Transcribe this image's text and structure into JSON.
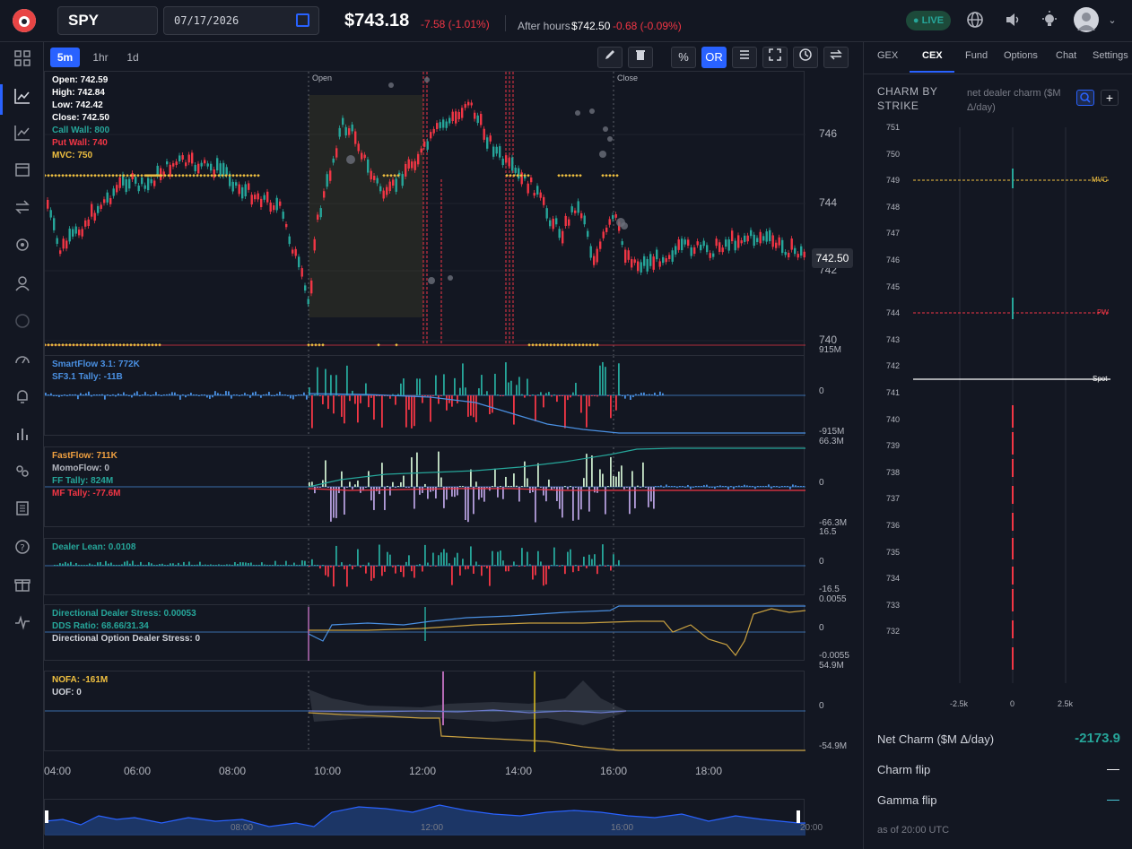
{
  "header": {
    "ticker": "SPY",
    "date": "07/17/2026",
    "price": "$743.18",
    "change": "-7.58 (-1.01%)",
    "after_hours_label": "After hours",
    "after_hours_price": "$742.50",
    "after_hours_change": "-0.68 (-0.09%)",
    "live_label": "● LIVE"
  },
  "timeframes": [
    "5m",
    "1hr",
    "1d"
  ],
  "toolbar": {
    "pencil_icon": "pencil-icon",
    "trash_icon": "trash-icon",
    "percent_label": "%",
    "or_label": "OR",
    "menu_icon": "menu-icon",
    "fullscreen_icon": "fullscreen-icon",
    "clock_icon": "clock-icon",
    "swap_icon": "swap-icon"
  },
  "sidebar_icons": [
    "grid-icon",
    "chart-line-icon",
    "trend-icon",
    "calendar-icon",
    "transfer-icon",
    "target-icon",
    "user-icon",
    "chat-icon",
    "gauge-icon",
    "bell-icon",
    "bar-chart-icon",
    "group-icon",
    "news-icon",
    "help-icon",
    "gift-icon",
    "pulse-icon"
  ],
  "price_pane": {
    "open": "Open: 742.59",
    "high": "High: 742.84",
    "low": "Low: 742.42",
    "close": "Close: 742.50",
    "call_wall": "Call Wall: 800",
    "put_wall": "Put Wall: 740",
    "mvc": "MVC: 750",
    "session_open": "Open",
    "session_close": "Close",
    "last_price": "742.50",
    "axis": [
      "746",
      "744",
      "742",
      "740"
    ]
  },
  "panes": {
    "smartflow": {
      "line1": "SmartFlow 3.1: 772K",
      "line2": "SF3.1 Tally: -11B",
      "top": "915M",
      "zero": "0",
      "bottom": "-915M"
    },
    "fastflow": {
      "line1": "FastFlow: 711K",
      "line2": "MomoFlow: 0",
      "line3": "FF Tally: 824M",
      "line4": "MF Tally: -77.6M",
      "top": "66.3M",
      "zero": "0",
      "bottom": "-66.3M"
    },
    "dealer": {
      "line1": "Dealer Lean: 0.0108",
      "top": "16.5",
      "zero": "0",
      "bottom": "-16.5"
    },
    "dds": {
      "line1": "Directional Dealer Stress: 0.00053",
      "line2": "DDS Ratio: 68.66/31.34",
      "line3": "Directional Option Dealer Stress: 0",
      "top": "0.0055",
      "zero": "0",
      "bottom": "-0.0055"
    },
    "nofa": {
      "line1": "NOFA: -161M",
      "line2": "UOF: 0",
      "top": "54.9M",
      "zero": "0",
      "bottom": "-54.9M"
    }
  },
  "time_axis": [
    "04:00",
    "06:00",
    "08:00",
    "10:00",
    "12:00",
    "14:00",
    "16:00",
    "18:00"
  ],
  "navigator": [
    "08:00",
    "12:00",
    "16:00",
    "20:00"
  ],
  "colors": {
    "accent": "#2962ff",
    "up": "#26a69a",
    "down": "#f23645",
    "mvc": "#f0c040",
    "flow_line": "#4a90e2"
  },
  "right_panel": {
    "tabs": [
      "GEX",
      "CEX",
      "Fund",
      "Options",
      "Chat",
      "Settings"
    ],
    "active_tab": "CEX",
    "title": "CHARM BY STRIKE",
    "subtitle": "net dealer charm ($M Δ/day)",
    "search_icon": "search-icon",
    "add_label": "+",
    "strikes": [
      "751",
      "750",
      "749",
      "748",
      "747",
      "746",
      "745",
      "744",
      "743",
      "742",
      "741",
      "740",
      "739",
      "738",
      "737",
      "736",
      "735",
      "734",
      "733",
      "732"
    ],
    "x_ticks": [
      "-2.5k",
      "0",
      "2.5k"
    ],
    "tags": {
      "mvc": "MVC",
      "pw": "PW",
      "spot": "Spot"
    },
    "net_charm_label": "Net Charm ($M Δ/day)",
    "net_charm_value": "-2173.9",
    "charm_flip_label": "Charm flip",
    "charm_flip_value": "—",
    "gamma_flip_label": "Gamma flip",
    "gamma_flip_value": "—",
    "as_of": "as of 20:00 UTC"
  }
}
